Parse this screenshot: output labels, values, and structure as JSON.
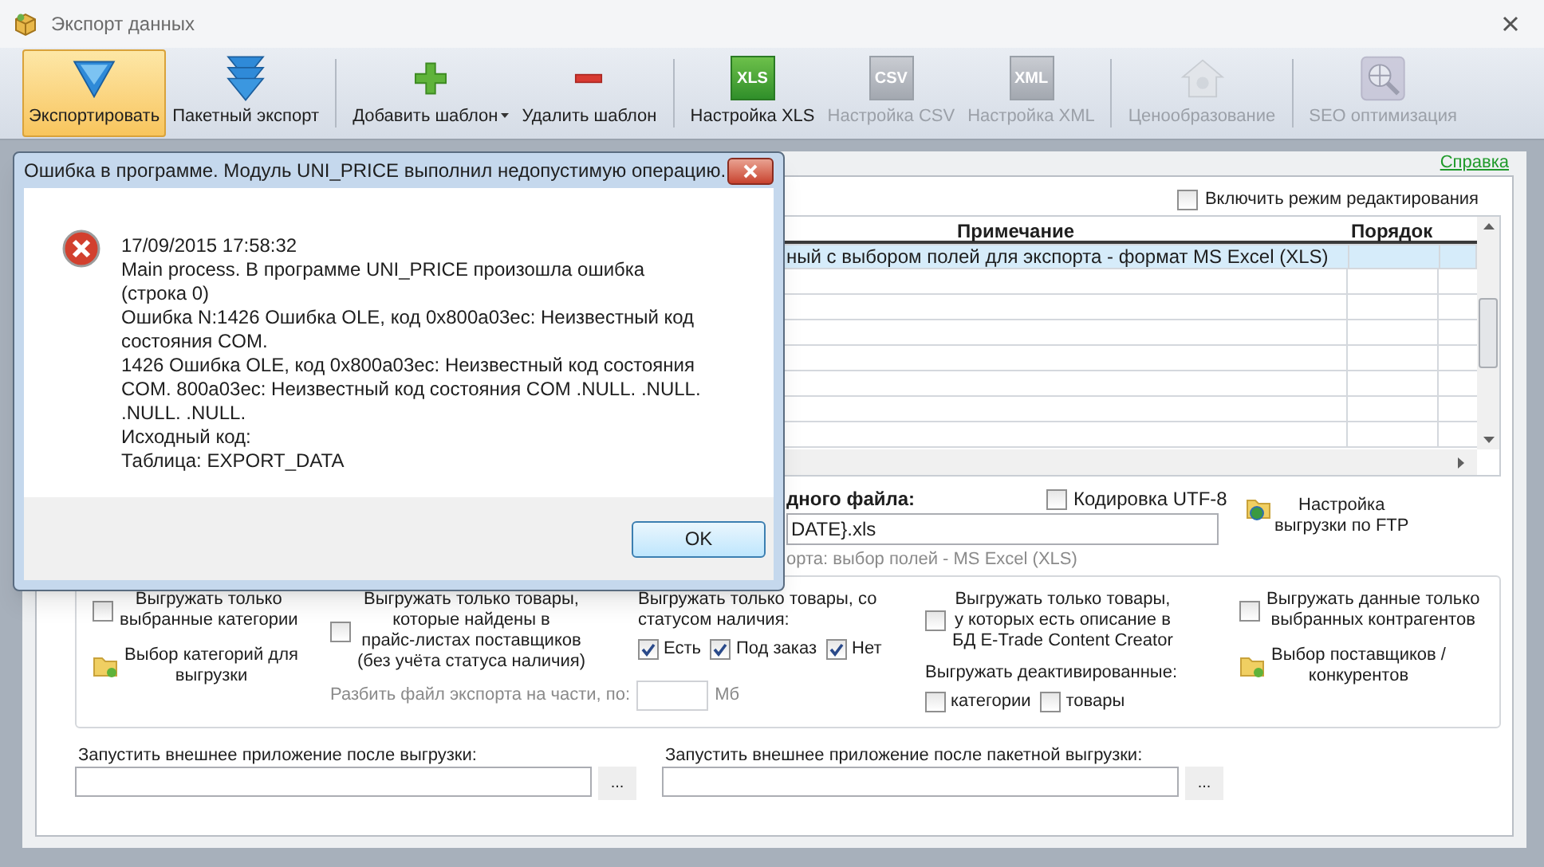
{
  "window": {
    "title": "Экспорт данных"
  },
  "toolbar_groups": [
    [
      {
        "kind": "export",
        "label": "Экспортировать",
        "selected": true,
        "disabled": false
      },
      {
        "kind": "batch_export",
        "label": "Пакетный экспорт",
        "selected": false,
        "disabled": false
      }
    ],
    [
      {
        "kind": "add",
        "label": "Добавить шаблон",
        "selected": false,
        "disabled": false,
        "dropdown": true
      },
      {
        "kind": "remove",
        "label": "Удалить шаблон",
        "selected": false,
        "disabled": false
      }
    ],
    [
      {
        "kind": "badge",
        "badge": "XLS",
        "label": "Настройка XLS",
        "selected": false,
        "disabled": false
      },
      {
        "kind": "badge",
        "badge": "CSV",
        "label": "Настройка CSV",
        "selected": false,
        "disabled": true
      },
      {
        "kind": "badge",
        "badge": "XML",
        "label": "Настройка XML",
        "selected": false,
        "disabled": true
      }
    ],
    [
      {
        "kind": "pricing",
        "label": "Ценообразование",
        "selected": false,
        "disabled": true
      }
    ],
    [
      {
        "kind": "seo",
        "label": "SEO оптимизация",
        "selected": false,
        "disabled": true
      }
    ]
  ],
  "help_link": "Справка",
  "edit_mode": {
    "label": "Включить режим редактирования",
    "checked": false
  },
  "table": {
    "columns": [
      "Примечание",
      "Порядок"
    ],
    "rows": [
      {
        "note": "ный с выбором полей для экспорта - формат MS Excel (XLS)",
        "selected": true
      }
    ]
  },
  "output_file": {
    "label": "дного файла:",
    "value": "DATE}.xls",
    "hint": "орта: выбор полей - MS Excel (XLS)"
  },
  "utf8": {
    "label": "Кодировка UTF-8",
    "checked": false
  },
  "ftp_button": "Настройка\nвыгрузки по FTP",
  "option_columns": [
    [
      {
        "kind": "checkbox",
        "label": "Выгружать только\nвыбранные категории",
        "checked": false
      },
      {
        "kind": "link",
        "label": "Выбор категорий для\nвыгрузки"
      }
    ],
    [
      {
        "kind": "checkbox",
        "label": "Выгружать только товары,\nкоторые найдены в\nпрайс-листах поставщиков\n(без учёта статуса наличия)",
        "checked": false
      },
      {
        "kind": "number_field",
        "label": "Разбить файл экспорта на части, по:",
        "unit": "Мб"
      }
    ],
    [
      {
        "kind": "text",
        "label": "Выгружать только товары, со\nстатусом наличия:"
      },
      {
        "kind": "checkbox_row",
        "items": [
          {
            "label": "Есть",
            "checked": true
          },
          {
            "label": "Под заказ",
            "checked": true
          },
          {
            "label": "Нет",
            "checked": true
          }
        ]
      }
    ],
    [
      {
        "kind": "checkbox",
        "label": "Выгружать только товары,\nу которых есть описание в\nБД E-Trade Content Creator",
        "checked": false
      },
      {
        "kind": "text",
        "label": "Выгружать деактивированные:"
      },
      {
        "kind": "checkbox_row",
        "items": [
          {
            "label": "категории",
            "checked": false
          },
          {
            "label": "товары",
            "checked": false
          }
        ]
      }
    ],
    [
      {
        "kind": "checkbox",
        "label": "Выгружать данные только\nвыбранных контрагентов",
        "checked": false
      },
      {
        "kind": "link",
        "label": "Выбор поставщиков /\nконкурентов"
      }
    ]
  ],
  "launch_fields": [
    {
      "label": "Запустить внешнее приложение после выгрузки:",
      "button": "..."
    },
    {
      "label": "Запустить внешнее приложение после пакетной выгрузки:",
      "button": "..."
    }
  ],
  "dialog": {
    "title": "Ошибка в программе. Модуль UNI_PRICE выполнил недопустимую операцию.",
    "lines": [
      "17/09/2015 17:58:32",
      "Main process. В программе UNI_PRICE произошла ошибка (строка 0)",
      "Ошибка N:1426 Ошибка OLE, код 0x800a03ec: Неизвестный код состояния COM.",
      "1426 Ошибка OLE, код 0x800a03ec: Неизвестный код состояния COM. 800a03ec: Неизвестный код состояния COM .NULL. .NULL. .NULL. .NULL.",
      "Исходный код:",
      "Таблица: EXPORT_DATA"
    ],
    "button": "OK"
  }
}
